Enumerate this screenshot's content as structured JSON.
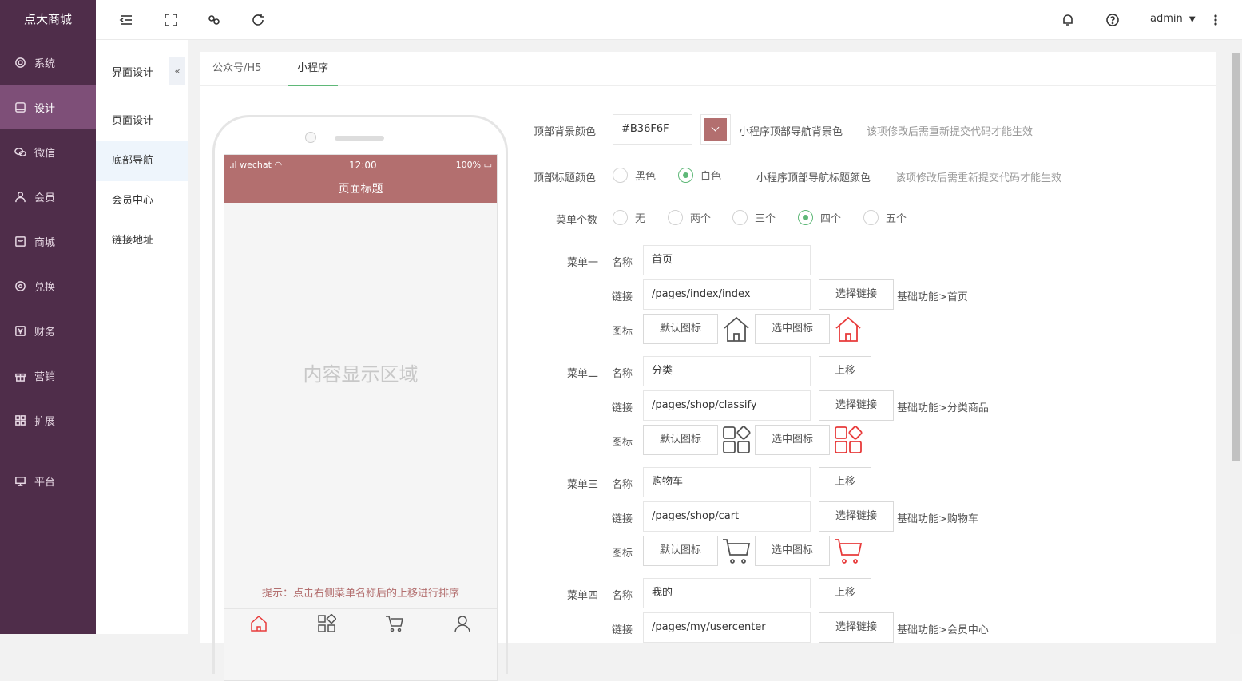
{
  "app": {
    "title": "点大商城"
  },
  "sidebar": {
    "items": [
      {
        "label": "系统",
        "icon": "gear-icon"
      },
      {
        "label": "设计",
        "icon": "monitor-icon"
      },
      {
        "label": "微信",
        "icon": "wechat-icon"
      },
      {
        "label": "会员",
        "icon": "user-icon"
      },
      {
        "label": "商城",
        "icon": "shop-icon"
      },
      {
        "label": "兑换",
        "icon": "exchange-icon"
      },
      {
        "label": "财务",
        "icon": "yen-icon"
      },
      {
        "label": "营销",
        "icon": "gift-icon"
      },
      {
        "label": "扩展",
        "icon": "grid-icon"
      },
      {
        "label": "平台",
        "icon": "desktop-icon"
      }
    ]
  },
  "topbar": {
    "user": "admin"
  },
  "subnav": {
    "title": "界面设计",
    "collapse": "«",
    "items": [
      "页面设计",
      "底部导航",
      "会员中心",
      "链接地址"
    ]
  },
  "tabs": [
    "公众号/H5",
    "小程序"
  ],
  "phone": {
    "carrier": "wechat",
    "time": "12:00",
    "battery": "100%",
    "title": "页面标题",
    "content": "内容显示区域",
    "hint": "提示：点击右侧菜单名称后的上移进行排序"
  },
  "form": {
    "bg_label": "顶部背景颜色",
    "bg_value": "#B36F6F",
    "bg_desc": "小程序顶部导航背景色",
    "bg_note": "该项修改后需重新提交代码才能生效",
    "title_label": "顶部标题颜色",
    "title_opts": [
      "黑色",
      "白色"
    ],
    "title_desc": "小程序顶部导航标题颜色",
    "title_note": "该项修改后需重新提交代码才能生效",
    "count_label": "菜单个数",
    "count_opts": [
      "无",
      "两个",
      "三个",
      "四个",
      "五个"
    ],
    "name_label": "名称",
    "link_label": "链接",
    "icon_label": "图标",
    "choose_link": "选择链接",
    "default_icon": "默认图标",
    "selected_icon": "选中图标",
    "move_up": "上移",
    "menus": [
      {
        "label": "菜单一",
        "name": "首页",
        "link": "/pages/index/index",
        "link_desc": "基础功能>首页"
      },
      {
        "label": "菜单二",
        "name": "分类",
        "link": "/pages/shop/classify",
        "link_desc": "基础功能>分类商品"
      },
      {
        "label": "菜单三",
        "name": "购物车",
        "link": "/pages/shop/cart",
        "link_desc": "基础功能>购物车"
      },
      {
        "label": "菜单四",
        "name": "我的",
        "link": "/pages/my/usercenter",
        "link_desc": "基础功能>会员中心"
      }
    ]
  },
  "colors": {
    "accent": "#b36f6f",
    "sidebar": "#4f2d4a",
    "active": "#7e4f78",
    "green": "#5fb878",
    "red": "#e83b3b"
  }
}
